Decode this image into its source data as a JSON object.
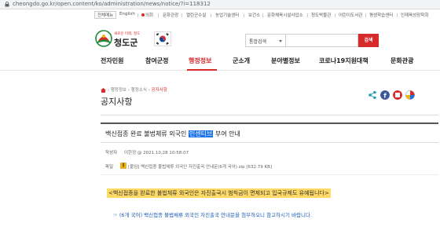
{
  "browser": {
    "url": "cheongdo.go.kr/open.content/ko/administration/news/notice/?i=118312"
  },
  "utility_bar": {
    "items": [
      "전체메뉴",
      "English",
      "의회",
      "문화관광",
      "열린군수실",
      "농업기술센터",
      "보건소",
      "문화체육시설사업소",
      "청도박물관",
      "어린이도서관",
      "평생학습센터",
      "인재육성장학회"
    ]
  },
  "header": {
    "logo_slogan": "새로운 미래, 청도",
    "logo_name": "청도군",
    "search_scope": "통합검색",
    "search_button": "검색"
  },
  "nav": {
    "tabs": [
      "전자민원",
      "참여군정",
      "행정정보",
      "군소개",
      "분야별정보",
      "코로나19지원대책",
      "문화관광"
    ],
    "active_index": 2
  },
  "breadcrumb": {
    "items": [
      "행정정보",
      "행정소식"
    ],
    "current": "공지사항"
  },
  "page_title": "공지사항",
  "post": {
    "title_before": "백신접종 완료 불법체류 외국인 ",
    "title_highlight": "인센티브",
    "title_after": " 부여 안내",
    "author_label": "작성자",
    "author_value": "이한정 @ 2021.10.28 10:58:07",
    "file_label": "파일",
    "file_value": "[붙임] 백신접종 불법체류 외국인 자진출국 안내문(6개 국어).zip [632.79 KB]",
    "notice_text": "<백신접종을 완료한 불법체류 외국인은 자진출국시 범칙금이 면제되고 입국규제도 유예됩니다>",
    "body_text": "☞ (6개 국어)  백신접종 불법체류  외국인 자진출국 안내문을 첨부하오니 참고하시기 바랍니다."
  },
  "colors": {
    "brand_red": "#d62b2b",
    "highlight_yellow": "#ffd966",
    "selection_blue": "#1a73e8"
  }
}
